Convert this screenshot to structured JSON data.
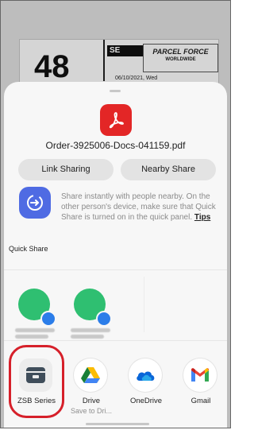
{
  "background_doc": {
    "number": "48",
    "box_label": "SE",
    "logo_text": "PARCEL FORCE",
    "logo_sub": "WORLDWIDE",
    "date": "06/10/2021, Wed"
  },
  "share_sheet": {
    "file_name": "Order-3925006-Docs-041159.pdf",
    "buttons": {
      "link_sharing": "Link Sharing",
      "nearby_share": "Nearby Share"
    },
    "quick_share": {
      "label": "Quick Share",
      "description": "Share instantly with people nearby. On the other person's device, make sure that Quick Share is turned on in the quick panel.",
      "tips": "Tips"
    },
    "apps": [
      {
        "name": "ZSB Series",
        "sub": ""
      },
      {
        "name": "Drive",
        "sub": "Save to Dri..."
      },
      {
        "name": "OneDrive",
        "sub": ""
      },
      {
        "name": "Gmail",
        "sub": ""
      }
    ]
  },
  "colors": {
    "highlight": "#d6202a",
    "pdf": "#e32626",
    "quick_share": "#4f6be3",
    "contact_avatar": "#2fbf71"
  }
}
